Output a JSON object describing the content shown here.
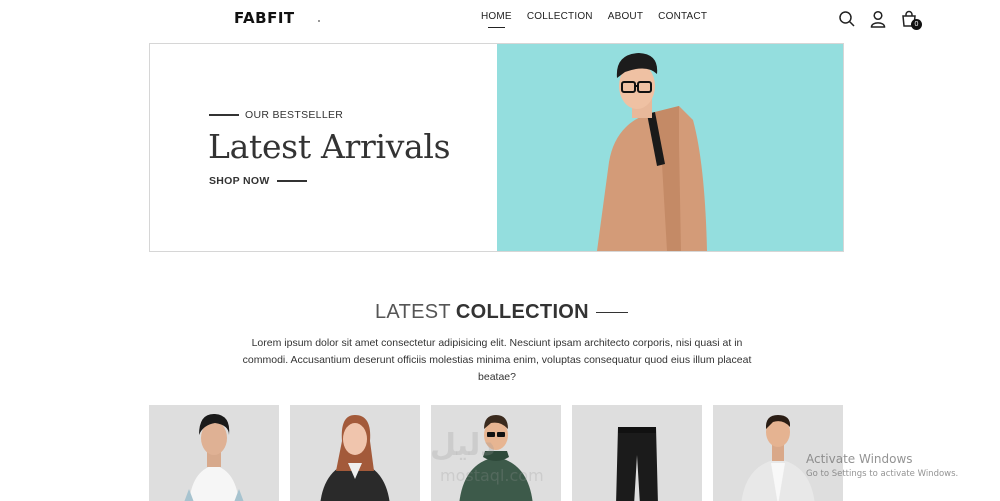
{
  "nav": {
    "logo": "FABFIT",
    "items": [
      {
        "label": "HOME",
        "active": true
      },
      {
        "label": "COLLECTION",
        "active": false
      },
      {
        "label": "ABOUT",
        "active": false
      },
      {
        "label": "CONTACT",
        "active": false
      }
    ],
    "icons": [
      "search-icon",
      "user-icon",
      "shopping-bag-icon"
    ],
    "cart_count": "0"
  },
  "hero": {
    "eyebrow": "OUR BESTSELLER",
    "title": "Latest Arrivals",
    "cta": "SHOP NOW",
    "image_bg": "#94dede"
  },
  "collection": {
    "title_light": "LATEST",
    "title_bold": "COLLECTION",
    "description": "Lorem ipsum dolor sit amet consectetur adipisicing elit. Nesciunt ipsam architecto corporis, nisi quasi at in commodi. Accusantium deserunt officiis molestias minima enim, voluptas consequatur quod eius illum placeat beatae?",
    "products": [
      {
        "image": "man-white-tshirt"
      },
      {
        "image": "woman-leather-jacket"
      },
      {
        "image": "man-green-hoodie"
      },
      {
        "image": "black-pants"
      },
      {
        "image": "man-denim-jacket"
      }
    ]
  },
  "watermark": {
    "big": "دليل",
    "small": "mostaql.com"
  },
  "os_overlay": {
    "line1": "Activate Windows",
    "line2": "Go to Settings to activate Windows."
  }
}
